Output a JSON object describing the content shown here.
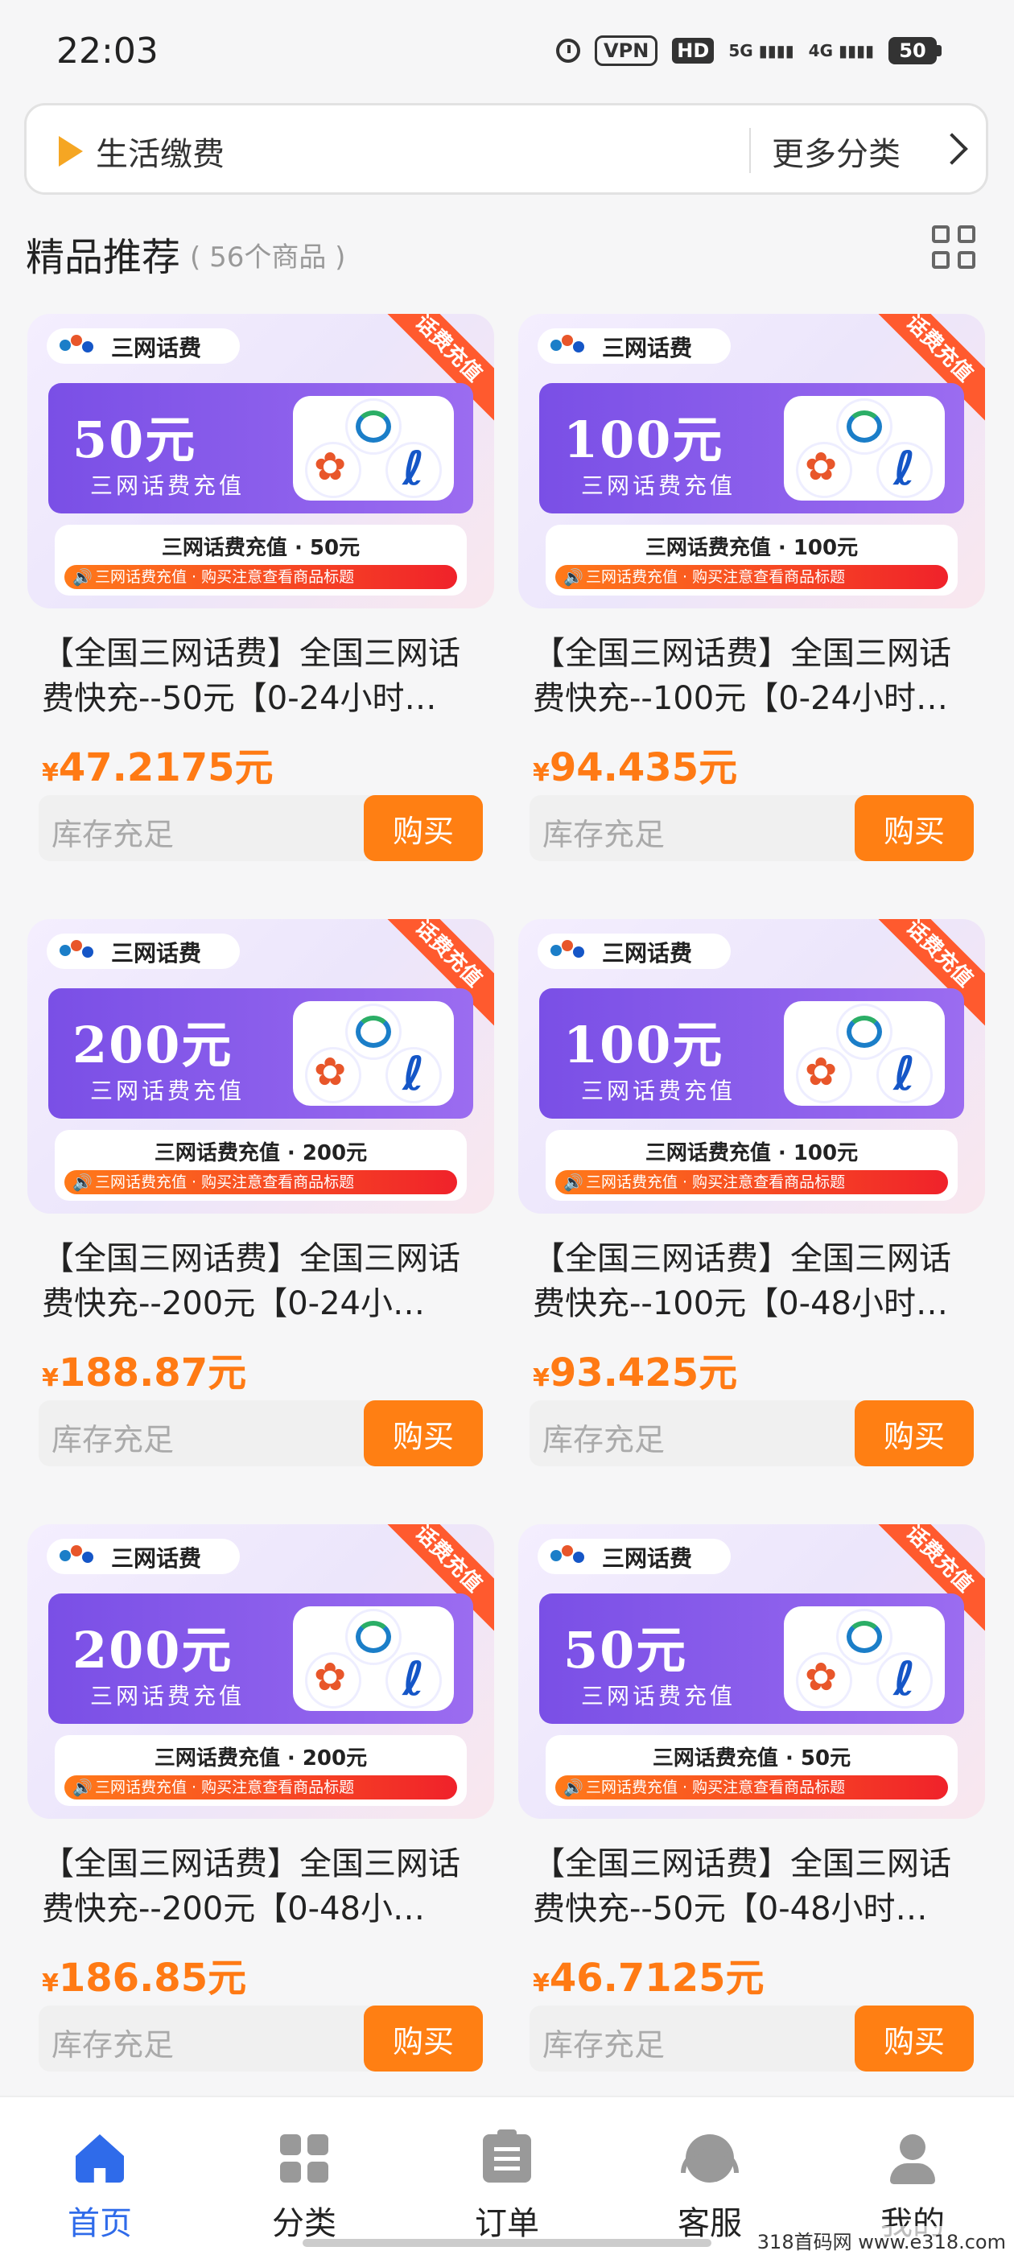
{
  "status_bar": {
    "time": "22:03",
    "vpn": "VPN",
    "hd": "HD",
    "net1": "5G",
    "net2": "4G",
    "battery": "50"
  },
  "category_bar": {
    "label": "生活缴费",
    "more": "更多分类"
  },
  "section": {
    "title": "精品推荐",
    "count": "( 56个商品 )"
  },
  "products": [
    {
      "thumb_amount": "50元",
      "thumb_sub": "三网话费充值",
      "brand": "三网话费",
      "ribbon": "话费充值",
      "strip_title": "三网话费充值 · 50元",
      "strip_note": "三网话费充值 · 购买注意查看商品标题",
      "title_line1": "【全国三网话费】全国三网话",
      "title_line2": "费快充--50元【0-24小时…",
      "currency": "¥",
      "price": "47.2175元",
      "stock": "库存充足",
      "buy": "购买"
    },
    {
      "thumb_amount": "100元",
      "thumb_sub": "三网话费充值",
      "brand": "三网话费",
      "ribbon": "话费充值",
      "strip_title": "三网话费充值 · 100元",
      "strip_note": "三网话费充值 · 购买注意查看商品标题",
      "title_line1": "【全国三网话费】全国三网话",
      "title_line2": "费快充--100元【0-24小时…",
      "currency": "¥",
      "price": "94.435元",
      "stock": "库存充足",
      "buy": "购买"
    },
    {
      "thumb_amount": "200元",
      "thumb_sub": "三网话费充值",
      "brand": "三网话费",
      "ribbon": "话费充值",
      "strip_title": "三网话费充值 · 200元",
      "strip_note": "三网话费充值 · 购买注意查看商品标题",
      "title_line1": "【全国三网话费】全国三网话",
      "title_line2": "费快充--200元【0-24小…",
      "currency": "¥",
      "price": "188.87元",
      "stock": "库存充足",
      "buy": "购买"
    },
    {
      "thumb_amount": "100元",
      "thumb_sub": "三网话费充值",
      "brand": "三网话费",
      "ribbon": "话费充值",
      "strip_title": "三网话费充值 · 100元",
      "strip_note": "三网话费充值 · 购买注意查看商品标题",
      "title_line1": "【全国三网话费】全国三网话",
      "title_line2": "费快充--100元【0-48小时…",
      "currency": "¥",
      "price": "93.425元",
      "stock": "库存充足",
      "buy": "购买"
    },
    {
      "thumb_amount": "200元",
      "thumb_sub": "三网话费充值",
      "brand": "三网话费",
      "ribbon": "话费充值",
      "strip_title": "三网话费充值 · 200元",
      "strip_note": "三网话费充值 · 购买注意查看商品标题",
      "title_line1": "【全国三网话费】全国三网话",
      "title_line2": "费快充--200元【0-48小…",
      "currency": "¥",
      "price": "186.85元",
      "stock": "库存充足",
      "buy": "购买"
    },
    {
      "thumb_amount": "50元",
      "thumb_sub": "三网话费充值",
      "brand": "三网话费",
      "ribbon": "话费充值",
      "strip_title": "三网话费充值 · 50元",
      "strip_note": "三网话费充值 · 购买注意查看商品标题",
      "title_line1": "【全国三网话费】全国三网话",
      "title_line2": "费快充--50元【0-48小时…",
      "currency": "¥",
      "price": "46.7125元",
      "stock": "库存充足",
      "buy": "购买"
    }
  ],
  "tabs": [
    {
      "label": "首页",
      "icon": "home-icon",
      "active": true
    },
    {
      "label": "分类",
      "icon": "category-icon",
      "active": false
    },
    {
      "label": "订单",
      "icon": "order-icon",
      "active": false
    },
    {
      "label": "客服",
      "icon": "customer-service-icon",
      "active": false
    },
    {
      "label": "我的",
      "icon": "profile-icon",
      "active": false
    }
  ],
  "watermark": "318首码网  www.e318.com",
  "colors": {
    "accent": "#ff7f13",
    "tab_active": "#2f6bea",
    "panel": "#8a5cec",
    "ribbon": "#ff5a2e"
  }
}
